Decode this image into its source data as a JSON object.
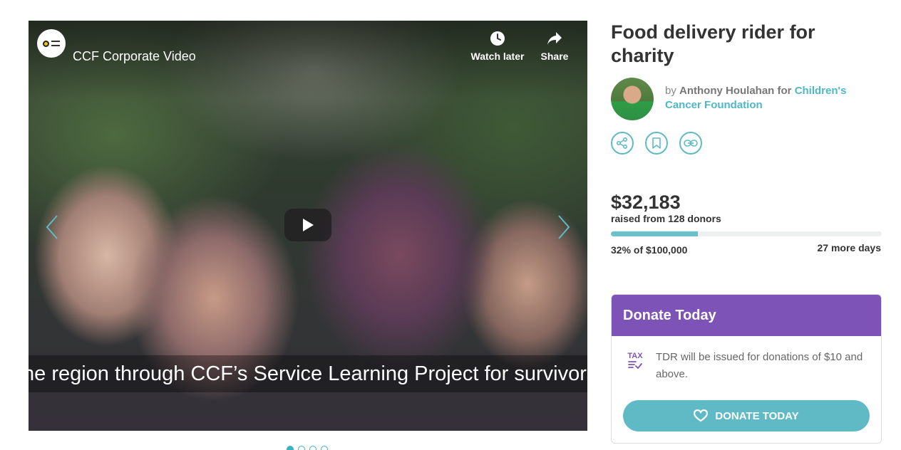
{
  "video": {
    "channel_title": "CCF Corporate Video",
    "watch_later_label": "Watch later",
    "share_label": "Share",
    "caption": "he region through CCF’s Service Learning Project for survivors"
  },
  "carousel": {
    "slides": 4,
    "active_index": 0
  },
  "campaign": {
    "title": "Food delivery rider for charity",
    "by_prefix": "by",
    "author": "Anthony Houlahan",
    "for_word": "for",
    "organisation": "Children's Cancer Foundation",
    "amount_raised": "$32,183",
    "donors_text": "raised from 128 donors",
    "progress_fraction": 0.32,
    "goal_text": "32% of $100,000",
    "days_left": "27 more days"
  },
  "actions": {
    "icons": [
      "share-icon",
      "bookmark-icon",
      "link-icon"
    ]
  },
  "donate": {
    "header": "Donate Today",
    "tax_badge": "TAX",
    "tdr_text": "TDR will be issued for donations of $10 and above.",
    "button_label": "DONATE TODAY"
  },
  "colors": {
    "accent": "#5fbac6",
    "purple": "#7d53b7",
    "text": "#333333"
  }
}
